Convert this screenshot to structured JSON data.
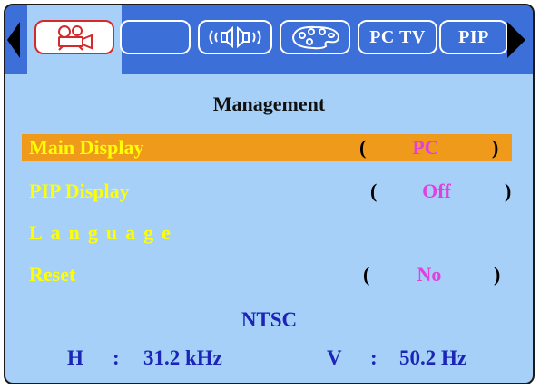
{
  "tabs": [
    {
      "name": "picture-tab",
      "icon": "projector-icon",
      "selected": true
    },
    {
      "name": "blank-tab",
      "icon": "",
      "selected": false
    },
    {
      "name": "audio-tab",
      "icon": "speaker-icon",
      "selected": false
    },
    {
      "name": "color-tab",
      "icon": "palette-icon",
      "selected": false
    },
    {
      "name": "pc-tv-tab",
      "label": "PC TV",
      "selected": false
    },
    {
      "name": "pip-tab",
      "label": "PIP",
      "selected": false
    }
  ],
  "menu": {
    "title": "Management",
    "items": [
      {
        "label": "Main Display",
        "value": "PC",
        "highlighted": true
      },
      {
        "label": "PIP Display",
        "value": "Off",
        "highlighted": false
      },
      {
        "label": "Language",
        "value": null,
        "highlighted": false
      },
      {
        "label": "Reset",
        "value": "No",
        "highlighted": false
      }
    ]
  },
  "signal": {
    "standard": "NTSC",
    "h_label": "H",
    "h_value": "31.2 kHz",
    "v_label": "V",
    "v_value": "50.2 Hz",
    "separator": ":"
  },
  "colors": {
    "tab_bar": "#3c6fd8",
    "panel": "#a6d0f7",
    "highlight": "#f09a1c",
    "label": "#ffff00",
    "value": "#e040e0",
    "info": "#1b25b8"
  }
}
